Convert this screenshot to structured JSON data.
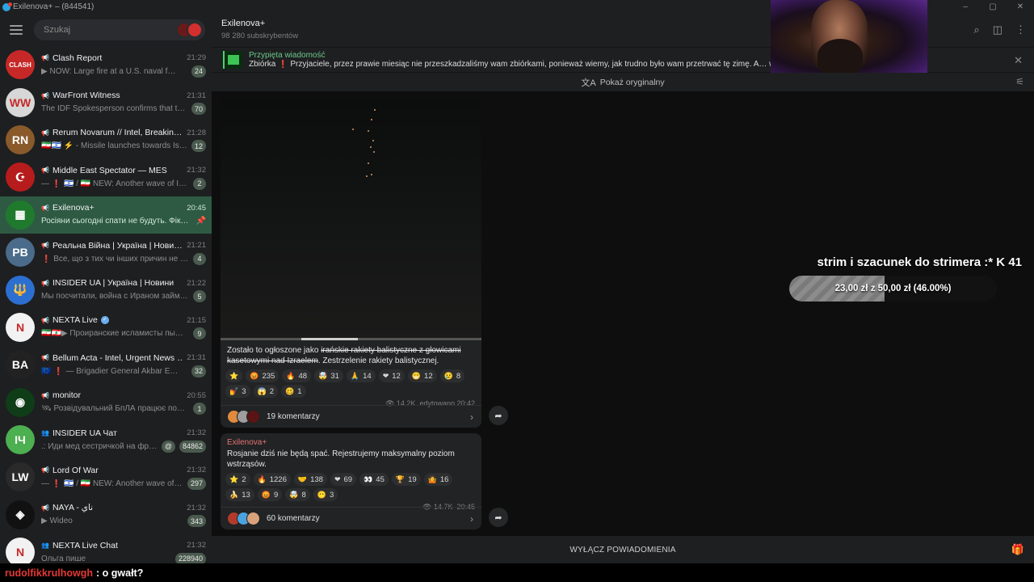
{
  "window": {
    "title": "Exilenova+ – (844541)",
    "controls": [
      "–",
      "▢",
      "✕"
    ]
  },
  "search": {
    "placeholder": "Szukaj"
  },
  "chats": [
    {
      "name": "Clash Report",
      "time": "21:29",
      "preview": "▶ NOW: Large fire at a U.S. naval f…",
      "badge": "24",
      "avatar_text": "CLASH",
      "avatar_color": "#c62828",
      "type": "channel"
    },
    {
      "name": "WarFront Witness",
      "time": "21:31",
      "preview": "The IDF Spokesperson confirms that th…",
      "badge": "70",
      "avatar_text": "WW",
      "avatar_color": "#d7d7d7",
      "type": "channel"
    },
    {
      "name": "Rerum Novarum // Intel, Breakin…",
      "time": "21:28",
      "preview": "🇮🇷🇮🇱 ⚡ - Missile launches towards Is…",
      "badge": "12",
      "avatar_text": "RN",
      "avatar_color": "#8a5a2b",
      "type": "channel"
    },
    {
      "name": "Middle East Spectator — MES",
      "time": "21:32",
      "preview": "— ❗ 🇮🇱 / 🇮🇷 NEW: Another wave of Ira…",
      "badge": "2",
      "avatar_text": "☪",
      "avatar_color": "#b71c1c",
      "type": "channel"
    },
    {
      "name": "Exilenova+",
      "time": "20:45",
      "preview": "Росіяни сьогодні спати не будуть. Фік…",
      "badge": "",
      "pinned": true,
      "avatar_text": "▦",
      "avatar_color": "#1f7a2e",
      "type": "channel",
      "active": true
    },
    {
      "name": "Реальна Війна | Україна | Нови…",
      "time": "21:21",
      "preview": "❗ Все, що з тих чи інших причин не …",
      "badge": "4",
      "avatar_text": "РВ",
      "avatar_color": "#4a6b8a",
      "type": "channel"
    },
    {
      "name": "INSIDER UA | Україна | Новини",
      "time": "21:22",
      "preview": "Мы посчитали, война с Ираном займ…",
      "badge": "5",
      "avatar_text": "🔱",
      "avatar_color": "#2c6fd1",
      "type": "channel"
    },
    {
      "name": "NEXTA Live",
      "time": "21:15",
      "preview": "🇮🇷🇱🇧▶ Проиранские исламисты пы…",
      "badge": "9",
      "verified": true,
      "avatar_text": "N",
      "avatar_color": "#f2f2f2",
      "type": "channel"
    },
    {
      "name": "Bellum Acta - Intel, Urgent News …",
      "time": "21:31",
      "preview": "🇪🇺 ❗ — Brigadier General Akbar E…",
      "badge": "32",
      "avatar_text": "BA",
      "avatar_color": "#222222",
      "type": "channel"
    },
    {
      "name": "monitor",
      "time": "20:55",
      "preview": "🛰 Розвідувальний БпЛА працює поб…",
      "badge": "1",
      "avatar_text": "◉",
      "avatar_color": "#0f3d17",
      "type": "channel"
    },
    {
      "name": "INSIDER UA Чат",
      "time": "21:32",
      "preview": ".: Иди мед сестричкой на фронт",
      "badge": "84862",
      "mention": true,
      "avatar_text": "IЧ",
      "avatar_color": "#4caf50",
      "type": "group"
    },
    {
      "name": "Lord Of War",
      "time": "21:32",
      "preview": "— ❗ 🇮🇱 / 🇮🇷 NEW: Another wave of Ir…",
      "badge": "297",
      "avatar_text": "LW",
      "avatar_color": "#2a2a2a",
      "type": "channel"
    },
    {
      "name": "NAYA - ناي",
      "time": "21:32",
      "preview": "▶ Wideo",
      "badge": "343",
      "avatar_text": "◈",
      "avatar_color": "#111111",
      "type": "channel"
    },
    {
      "name": "NEXTA Live Chat",
      "time": "21:32",
      "preview": "Ольга пише",
      "badge": "228940",
      "avatar_text": "N",
      "avatar_color": "#f2f2f2",
      "type": "group"
    }
  ],
  "header": {
    "title": "Exilenova+",
    "subtitle": "98 280 subskrybentów"
  },
  "pinned": {
    "label": "Przypięta wiadomość",
    "text": "Zbiórka ❗ Przyjaciele, przez prawie miesiąc nie przeszkadzaliśmy wam zbiórkami, ponieważ wiemy, jak trudno było wam przetrwać tę zimę. A… właśnie na waszyc…"
  },
  "translate": {
    "label": "Pokaż oryginalny"
  },
  "messages": [
    {
      "text_before": "Zostało to ogłoszone jako ",
      "text_strike": "irańskie rakiety balistyczne z głowicami kasetowymi nad Izraelem",
      "text_after": ". Zestrzelenie rakiety balistycznej.",
      "reactions": [
        {
          "emoji": "⭐",
          "count": ""
        },
        {
          "emoji": "😡",
          "count": "235"
        },
        {
          "emoji": "🔥",
          "count": "48"
        },
        {
          "emoji": "🤯",
          "count": "31"
        },
        {
          "emoji": "🙏",
          "count": "14"
        },
        {
          "emoji": "❤",
          "count": "12"
        },
        {
          "emoji": "😁",
          "count": "12"
        },
        {
          "emoji": "😢",
          "count": "8"
        },
        {
          "emoji": "💅",
          "count": "3"
        },
        {
          "emoji": "😱",
          "count": "2"
        },
        {
          "emoji": "🥴",
          "count": "1"
        }
      ],
      "views": "14.2K",
      "edited": "edytowano 20:42",
      "comments": "19 komentarzy"
    },
    {
      "author": "Exilenova+",
      "text": "Rosjanie dziś nie będą spać. Rejestrujemy maksymalny poziom wstrząsów.",
      "reactions": [
        {
          "emoji": "⭐",
          "count": "2"
        },
        {
          "emoji": "🔥",
          "count": "1226"
        },
        {
          "emoji": "🤝",
          "count": "138"
        },
        {
          "emoji": "❤",
          "count": "69"
        },
        {
          "emoji": "👀",
          "count": "45"
        },
        {
          "emoji": "🏆",
          "count": "19"
        },
        {
          "emoji": "🤷",
          "count": "16"
        },
        {
          "emoji": "🍌",
          "count": "13"
        },
        {
          "emoji": "😡",
          "count": "9"
        },
        {
          "emoji": "🤯",
          "count": "8"
        },
        {
          "emoji": "😶",
          "count": "3"
        }
      ],
      "views": "14.7K",
      "time": "20:45",
      "comments": "60 komentarzy"
    }
  ],
  "mute": {
    "label": "WYŁĄCZ POWIADOMIENIA"
  },
  "stream": {
    "goal_title": "strim i szacunek do strimera :*",
    "goal_count": "41",
    "goal_text": "23,00 zł z 50,00 zł (46.00%)",
    "goal_fraction": 0.46,
    "chat_user": "rudolfikkrulhowgh",
    "chat_message": ": o gwałt?"
  }
}
